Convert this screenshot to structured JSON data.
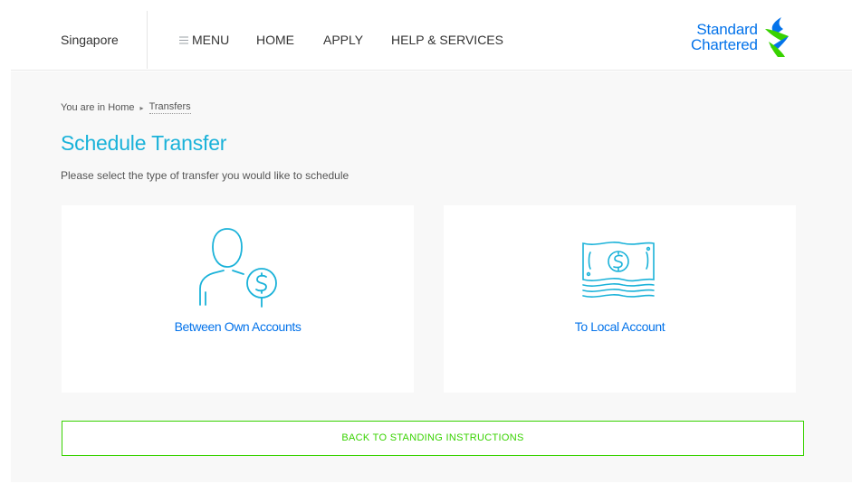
{
  "header": {
    "region": "Singapore",
    "menu_label": "MENU",
    "nav": {
      "home": "HOME",
      "apply": "APPLY",
      "help": "HELP & SERVICES"
    },
    "logo": {
      "line1": "Standard",
      "line2": "Chartered"
    }
  },
  "breadcrumb": {
    "prefix": "You are in Home",
    "separator": "▸",
    "current": "Transfers"
  },
  "page": {
    "title": "Schedule Transfer",
    "subtitle": "Please select the type of transfer you would like to schedule"
  },
  "options": [
    {
      "label": "Between Own Accounts",
      "icon": "person-dollar-icon"
    },
    {
      "label": "To Local Account",
      "icon": "banknote-icon"
    }
  ],
  "back_button": "BACK TO STANDING INSTRUCTIONS",
  "colors": {
    "primary_blue": "#0473ea",
    "title_cyan": "#1ab2d9",
    "accent_green": "#38d200",
    "background": "#f8f8f8"
  }
}
